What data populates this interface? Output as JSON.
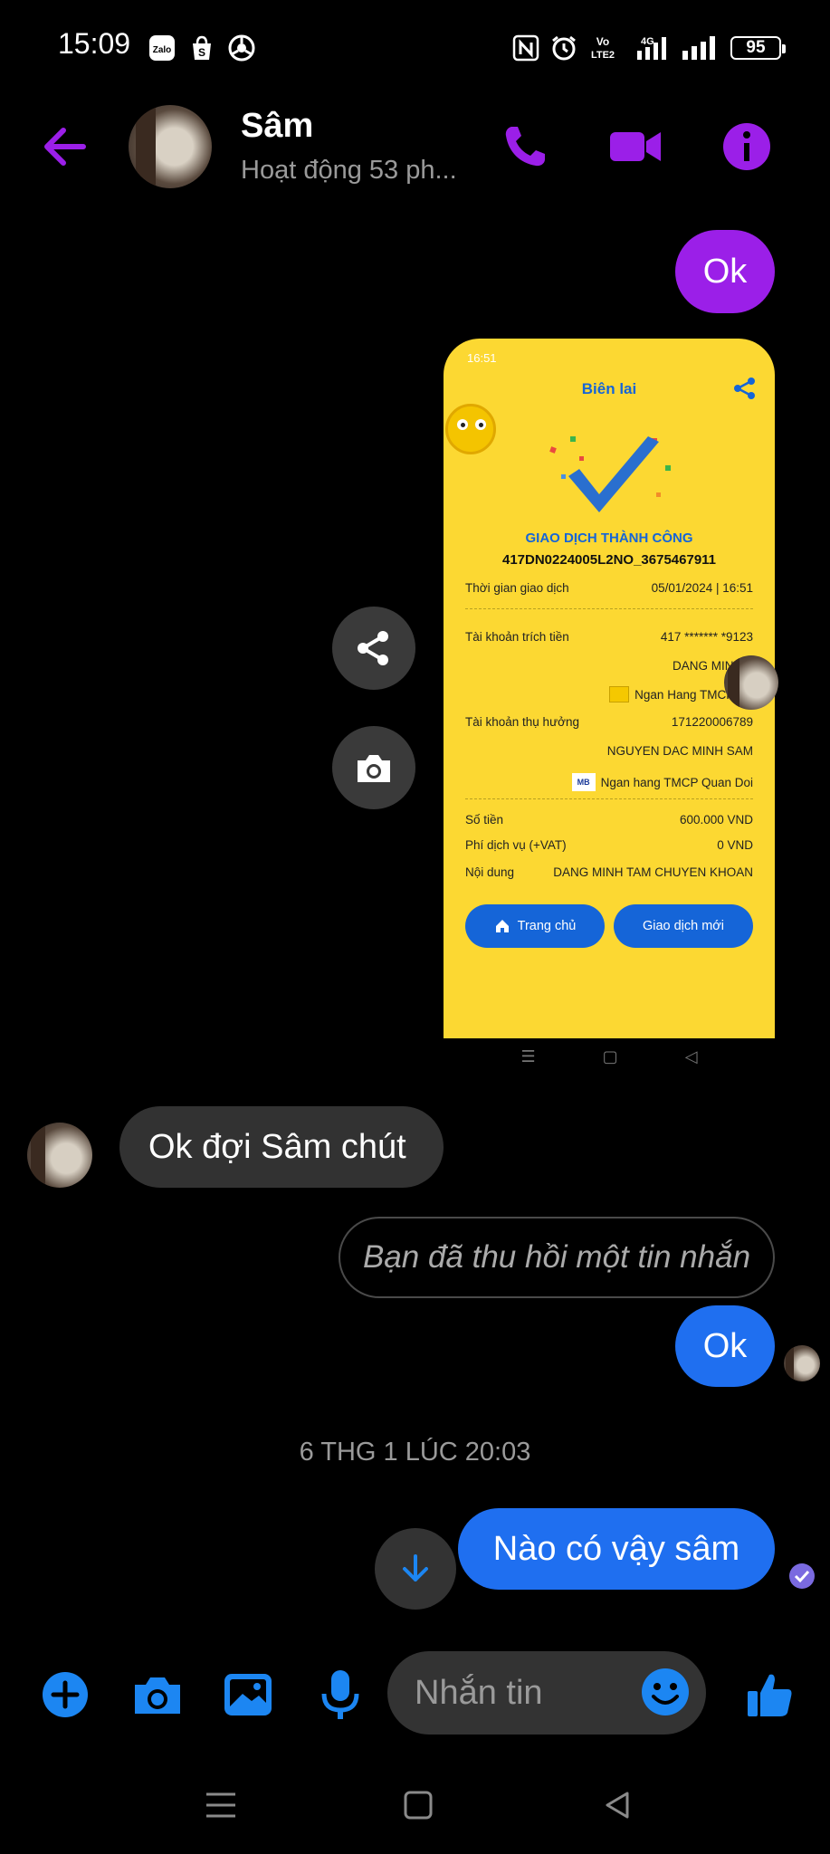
{
  "status_bar": {
    "time": "15:09",
    "app_icons": [
      "zalo-icon",
      "shopee-icon",
      "chrome-icon"
    ],
    "system_icons": [
      "nfc-icon",
      "alarm-icon",
      "volte-icon",
      "4g-signal-icon",
      "signal-icon"
    ],
    "battery": "95",
    "zalo_text": "Zalo",
    "volte_text": "Vo LTE2",
    "net_text": "4G"
  },
  "header": {
    "contact_name": "Sâm",
    "contact_status": "Hoạt động 53 ph...",
    "accent_color": "#9b1fe8"
  },
  "messages": {
    "sent_ok_1": "Ok",
    "received_1": "Ok đợi Sâm chút",
    "recalled": "Bạn đã thu hồi một tin nhắn",
    "sent_ok_2": "Ok",
    "date_separator": "6 THG 1 LÚC 20:03",
    "sent_last": "Nào có vậy sâm"
  },
  "receipt": {
    "status_time": "16:51",
    "title": "Biên lai",
    "success": "GIAO DỊCH THÀNH CÔNG",
    "code": "417DN0224005L2NO_3675467911",
    "time_label": "Thời gian giao dịch",
    "time_value": "05/01/2024 | 16:51",
    "from_label": "Tài khoản trích tiền",
    "from_account": "417 ******* *9123",
    "from_name": "DANG MINH T",
    "from_bank": "Ngan Hang TMCP Na",
    "to_label": "Tài khoản thụ hưởng",
    "to_account": "171220006789",
    "to_name": "NGUYEN DAC MINH SAM",
    "to_bank": "Ngan hang TMCP Quan Doi",
    "mb_logo": "MB",
    "amount_label": "Số tiền",
    "amount_value": "600.000 VND",
    "fee_label": "Phí dịch vụ (+VAT)",
    "fee_value": "0 VND",
    "content_label": "Nội dung",
    "content_value": "DANG MINH TAM CHUYEN KHOAN",
    "btn_home": "Trang chủ",
    "btn_new": "Giao dịch mới"
  },
  "composer": {
    "placeholder": "Nhắn tin",
    "icons": [
      "add-icon",
      "camera-icon",
      "gallery-icon",
      "microphone-icon",
      "emoji-icon",
      "like-icon"
    ]
  },
  "colors": {
    "purple": "#9b1fe8",
    "blue": "#1f6ff0",
    "composer_blue": "#1c86f2"
  }
}
